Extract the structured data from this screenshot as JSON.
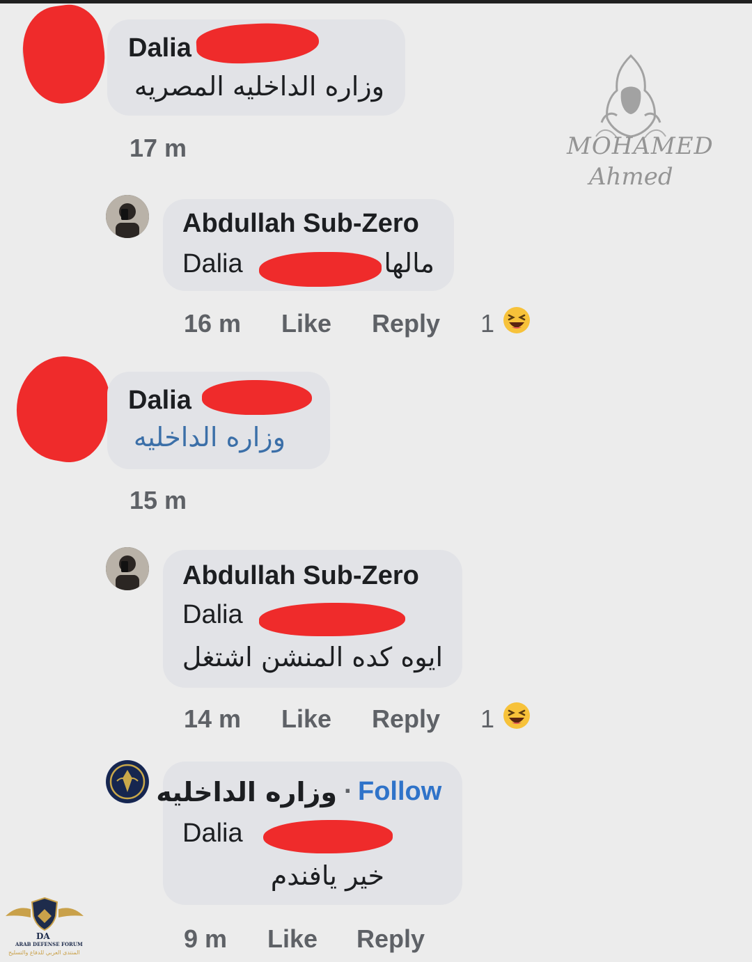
{
  "comments": [
    {
      "author": "Dalia",
      "text": "وزاره الداخليه المصريه",
      "time": "17 m"
    },
    {
      "author": "Abdullah Sub-Zero",
      "mention": "Dalia",
      "text": "مالها",
      "time": "16 m",
      "like_label": "Like",
      "reply_label": "Reply",
      "reaction_count": "1",
      "reaction_icon": "laughing-emoji"
    },
    {
      "author": "Dalia",
      "text": "وزاره الداخليه",
      "time": "15 m"
    },
    {
      "author": "Abdullah Sub-Zero",
      "mention": "Dalia",
      "text": "ايوه كده المنشن اشتغل",
      "time": "14 m",
      "like_label": "Like",
      "reply_label": "Reply",
      "reaction_count": "1",
      "reaction_icon": "laughing-emoji"
    },
    {
      "author": "وزاره الداخليه",
      "separator": "·",
      "follow_label": "Follow",
      "mention": "Dalia",
      "text": "خير يافندم",
      "time": "9 m",
      "like_label": "Like",
      "reply_label": "Reply"
    }
  ],
  "watermarks": {
    "artist_line1": "MOHAMED",
    "artist_line2": "Ahmed",
    "forum_initials": "DA",
    "forum_name": "ARAB DEFENSE FORUM",
    "forum_name_ar": "المنتدى العربي للدفاع والتسليح"
  },
  "colors": {
    "redaction": "#ef2b2b",
    "bubble": "#e2e3e7",
    "follow": "#2f73c9",
    "link_text": "#3b6fa8",
    "background": "#ececec"
  }
}
